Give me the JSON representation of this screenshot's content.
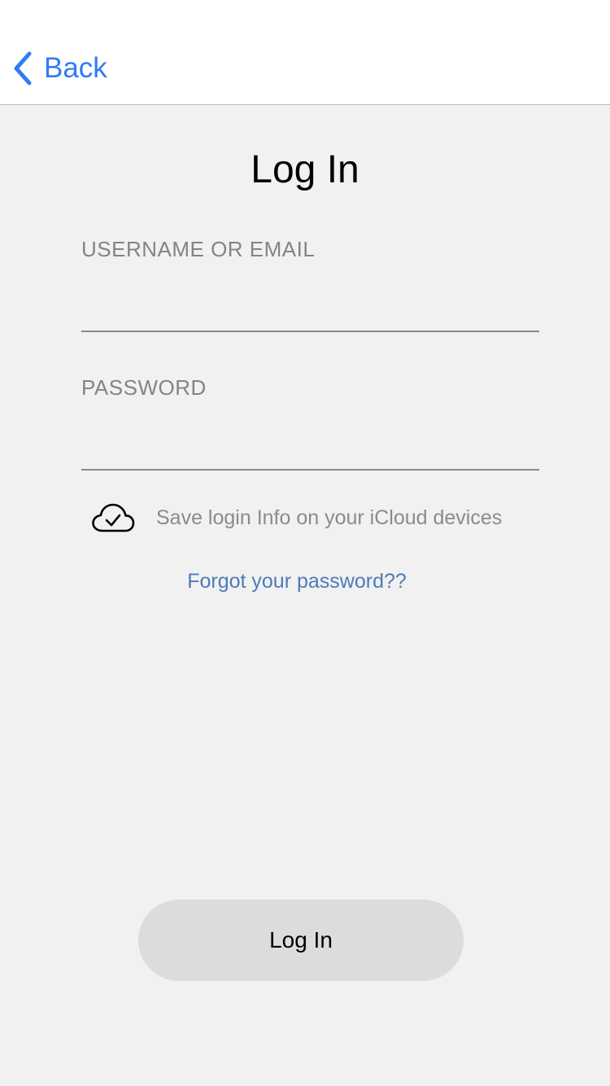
{
  "nav": {
    "back_label": "Back",
    "back_icon": "chevron-left-icon",
    "accent_color": "#2f7cf6"
  },
  "page": {
    "title": "Log In"
  },
  "form": {
    "username_label": "USERNAME OR EMAIL",
    "username_value": "",
    "username_placeholder": "",
    "password_label": "PASSWORD",
    "password_value": "",
    "password_placeholder": ""
  },
  "icloud": {
    "icon": "cloud-check-icon",
    "label": "Save login Info on your iCloud devices"
  },
  "forgot_password": {
    "label": "Forgot your password??",
    "color": "#4e7bb6"
  },
  "login_button": {
    "label": "Log In",
    "background": "#dcdcdc"
  }
}
